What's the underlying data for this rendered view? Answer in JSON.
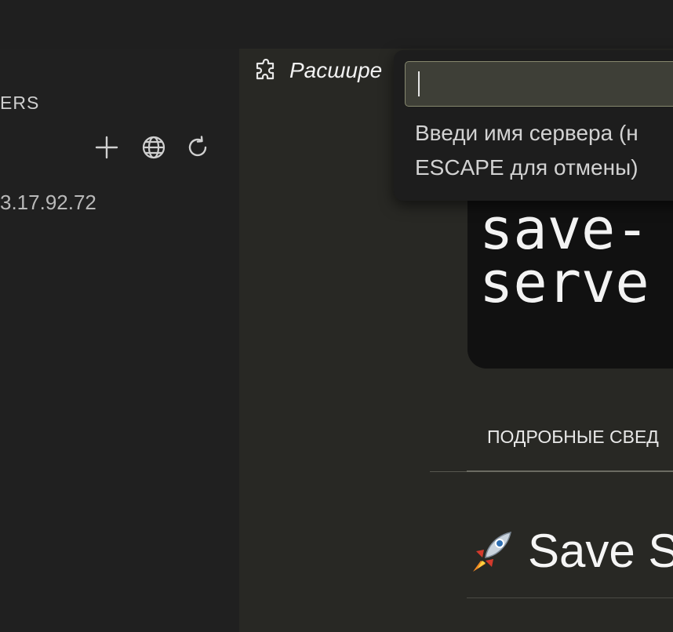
{
  "sidebar": {
    "title": "ERS",
    "actions": [
      {
        "icon": "plus-icon",
        "label": "Add server"
      },
      {
        "icon": "globe-icon",
        "label": "Open in browser"
      },
      {
        "icon": "refresh-icon",
        "label": "Refresh"
      }
    ],
    "servers": [
      {
        "label": "3.17.92.72"
      }
    ]
  },
  "editor": {
    "tab": {
      "icon": "extensions-icon",
      "label": "Расшире"
    },
    "logo_line1": "save-",
    "logo_line2": "serve",
    "details_tab": "ПОДРОБНЫЕ СВЕД",
    "readme_title": "Save S",
    "readme_icon": "rocket-icon"
  },
  "quick_input": {
    "value": "",
    "message_line1": "Введи имя сервера (н",
    "message_line2": "ESCAPE для отмены)"
  },
  "colors": {
    "sidebar_bg": "#202020",
    "editor_bg": "#282824",
    "input_bg": "#3e3f37",
    "input_border": "#86886e"
  }
}
